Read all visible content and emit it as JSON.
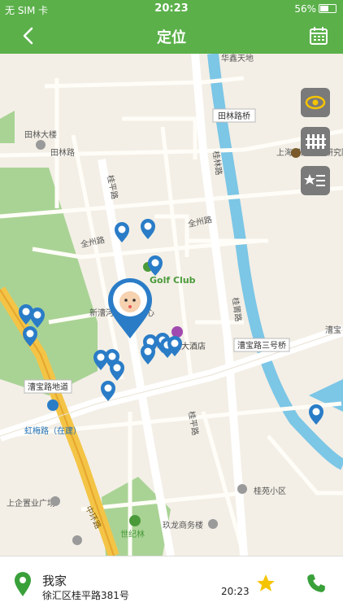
{
  "status_bar": {
    "carrier": "无 SIM 卡",
    "time": "20:23",
    "battery": "56%"
  },
  "nav": {
    "title": "定位"
  },
  "map_labels": [
    {
      "text": "华鑫天地"
    },
    {
      "text": "田林大楼"
    },
    {
      "text": "田林路"
    },
    {
      "text": "田林路桥"
    },
    {
      "text": "上海国际问题研究院"
    },
    {
      "text": "全州路"
    },
    {
      "text": "全州路"
    },
    {
      "text": "桂平路"
    },
    {
      "text": "桂林路"
    },
    {
      "text": "Golf Club"
    },
    {
      "text": "新漕河泾商务中心"
    },
    {
      "text": "桂箐路"
    },
    {
      "text": "漕宝路三号桥"
    },
    {
      "text": "漕宝"
    },
    {
      "text": "漕宝路地道"
    },
    {
      "text": "虹梅路（在建）"
    },
    {
      "text": "华美达大酒店"
    },
    {
      "text": "桂苑小区"
    },
    {
      "text": "世纪林"
    },
    {
      "text": "上企置业广场"
    },
    {
      "text": "玖龙商务楼"
    },
    {
      "text": "中环路"
    },
    {
      "text": "桂平路"
    }
  ],
  "bottom": {
    "name": "我家",
    "address": "徐汇区桂平路381号",
    "time": "20:23"
  },
  "colors": {
    "header": "#5bb04a",
    "pin": "#2a7cc7",
    "star": "#f5c400",
    "phone": "#3aa03a"
  }
}
